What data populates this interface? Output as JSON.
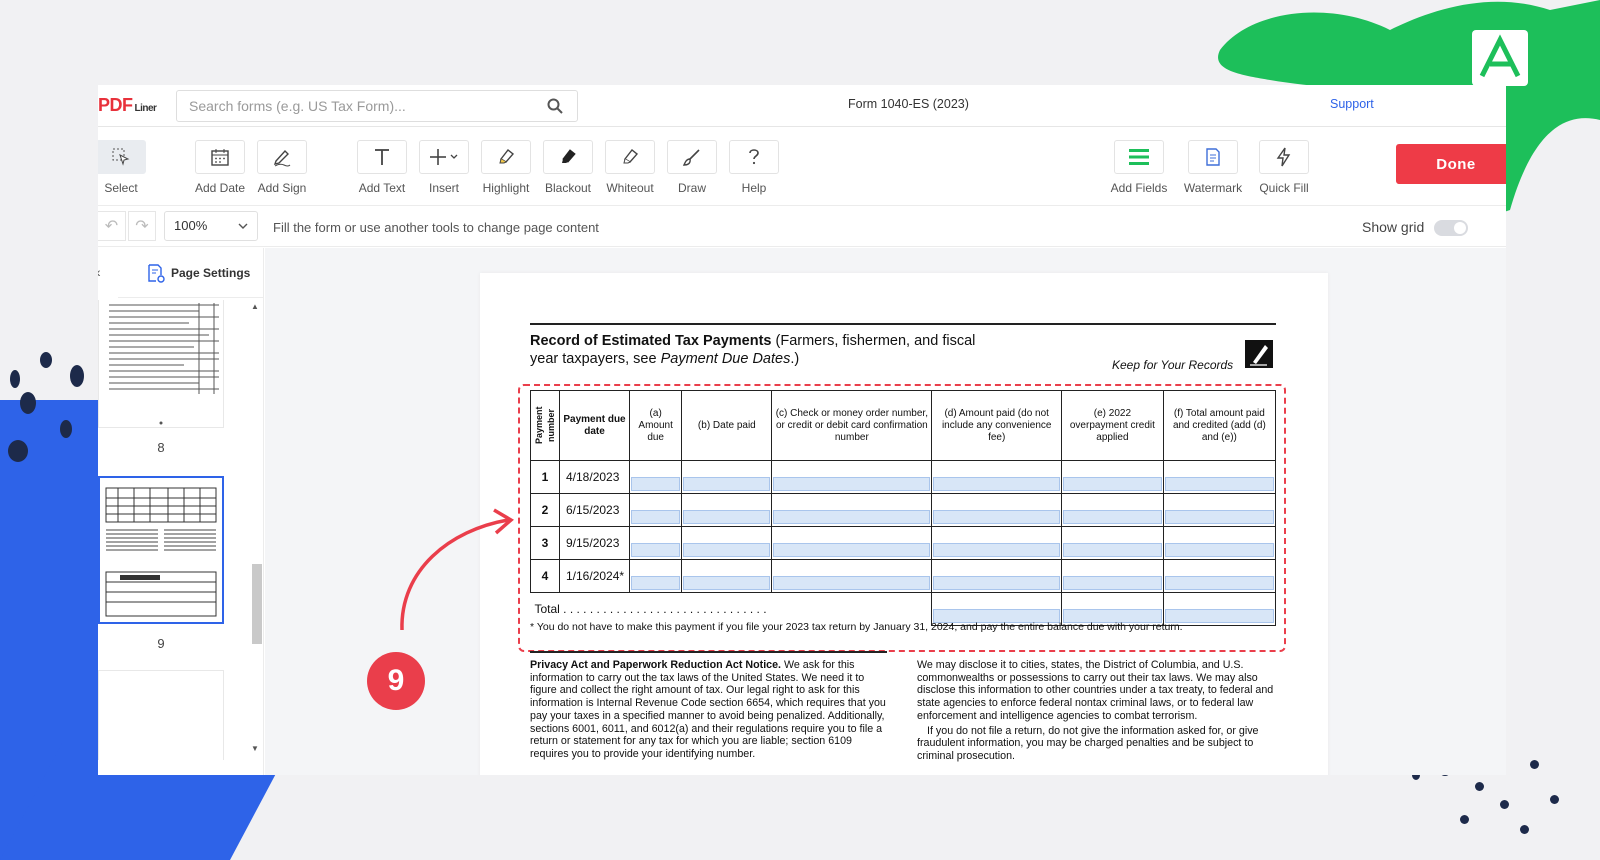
{
  "header": {
    "logo_main": "PDF",
    "logo_sub": "Liner",
    "search_placeholder": "Search forms (e.g. US Tax Form)...",
    "doc_title": "Form 1040-ES (2023)",
    "support_label": "Support"
  },
  "toolbar": {
    "tools": [
      {
        "label": "Select",
        "icon": "select-cursor-icon"
      },
      {
        "label": "Add Date",
        "icon": "calendar-icon"
      },
      {
        "label": "Add Sign",
        "icon": "signature-pen-icon"
      },
      {
        "label": "Add Text",
        "icon": "text-icon"
      },
      {
        "label": "Insert",
        "icon": "plus-icon"
      },
      {
        "label": "Highlight",
        "icon": "highlighter-icon"
      },
      {
        "label": "Blackout",
        "icon": "blackout-icon"
      },
      {
        "label": "Whiteout",
        "icon": "whiteout-icon"
      },
      {
        "label": "Draw",
        "icon": "brush-icon"
      },
      {
        "label": "Help",
        "icon": "question-icon"
      },
      {
        "label": "Add Fields",
        "icon": "fields-icon"
      },
      {
        "label": "Watermark",
        "icon": "watermark-icon"
      },
      {
        "label": "Quick Fill",
        "icon": "lightning-icon"
      }
    ],
    "done_label": "Done",
    "accent": "#ee3b47"
  },
  "subbar": {
    "zoom": "100%",
    "hint": "Fill the form or use another tools to change page content",
    "show_grid_label": "Show grid",
    "show_grid_on": false
  },
  "sidebar": {
    "page_settings_label": "Page Settings",
    "pages": [
      {
        "number": "8",
        "active": false
      },
      {
        "number": "9",
        "active": true
      }
    ]
  },
  "document": {
    "title_bold": "Record of Estimated Tax Payments",
    "title_rest": " (Farmers, fishermen, and fiscal",
    "title_line2_a": "year taxpayers, see ",
    "title_line2_italic": "Payment Due Dates",
    "title_line2_b": ".)",
    "keep_records": "Keep for Your Records",
    "columns": {
      "payment_number": "Payment number",
      "due_date": "Payment due date",
      "a": "(a) Amount due",
      "b": "(b) Date paid",
      "c": "(c) Check or money order number, or credit or debit card confirmation number",
      "d": "(d) Amount paid (do not include any convenience fee)",
      "e": "(e) 2022 overpayment credit applied",
      "f": "(f) Total amount paid and credited (add (d) and (e))"
    },
    "rows": [
      {
        "num": "1",
        "date": "4/18/2023"
      },
      {
        "num": "2",
        "date": "6/15/2023"
      },
      {
        "num": "3",
        "date": "9/15/2023"
      },
      {
        "num": "4",
        "date": "1/16/2024*"
      }
    ],
    "total_label": "Total . . . . . . . . . . . . . . . . . . . . . . . . . . . . . . .",
    "footnote": "* You do not have to make this payment if you file your 2023 tax return by January 31, 2024, and pay the entire balance due with your return.",
    "privacy_heading": "Privacy Act and Paperwork Reduction Act Notice.",
    "privacy_text": " We ask for this information to carry out the tax laws of the United States. We need it to figure and collect the right amount of tax. Our legal right to ask for this information is Internal Revenue Code section 6654, which requires that you pay your taxes in a specified manner to avoid being penalized. Additionally, sections 6001, 6011, and 6012(a) and their regulations require you to file a return or statement for any tax for which you are liable; section 6109 requires you to provide your identifying number.",
    "right_text_1": "We may disclose it to cities, states, the District of Columbia, and U.S. commonwealths or possessions to carry out their tax laws. We may also disclose this information to other countries under a tax treaty, to federal and state agencies to enforce federal nontax criminal laws, or to federal law enforcement and intelligence agencies to combat terrorism.",
    "right_text_2": "If you do not file a return, do not give the information asked for, or give fraudulent information, you may be charged penalties and be subject to criminal prosecution."
  },
  "annotation": {
    "step_number": "9",
    "color": "#ea3e4b"
  }
}
